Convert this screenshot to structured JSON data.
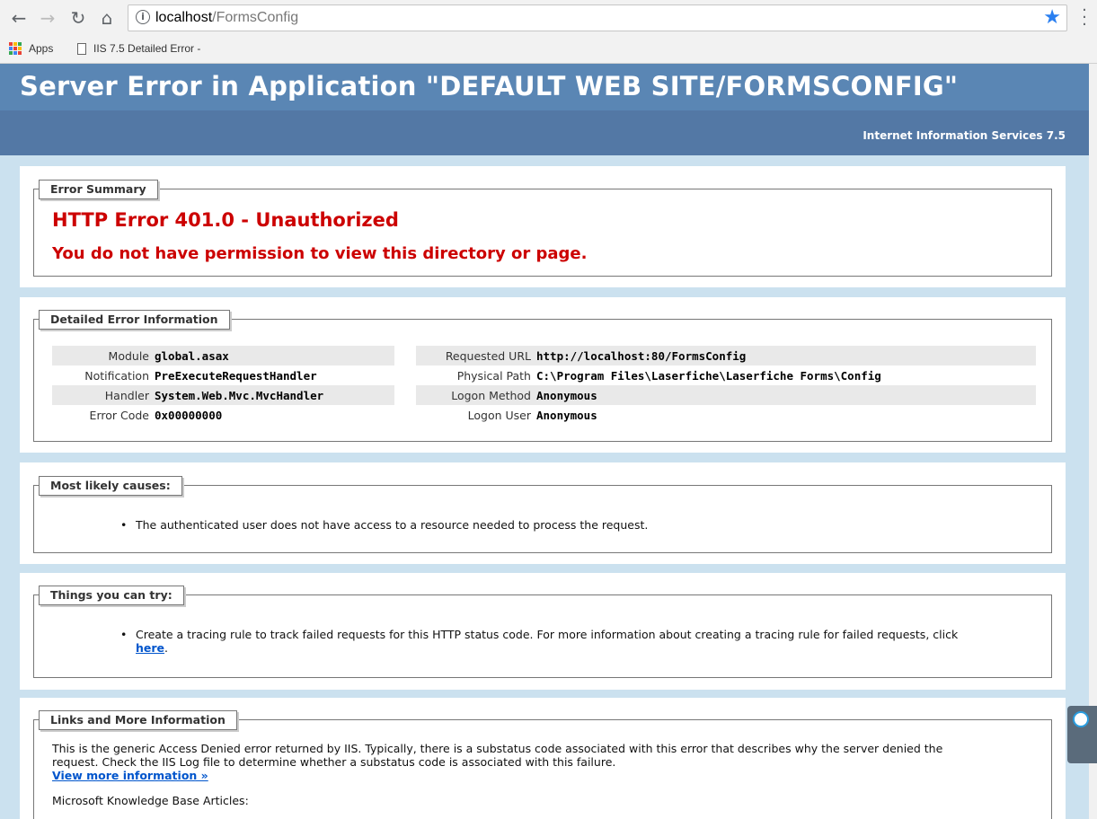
{
  "browser": {
    "url_host": "localhost",
    "url_path": "/FormsConfig",
    "bookmarks": [
      {
        "label": "Apps"
      },
      {
        "label": "IIS 7.5 Detailed Error -"
      }
    ]
  },
  "header": {
    "title": "Server Error in Application \"DEFAULT WEB SITE/FORMSCONFIG\"",
    "subtitle": "Internet Information Services 7.5"
  },
  "summary": {
    "legend": "Error Summary",
    "error_title": "HTTP Error 401.0 - Unauthorized",
    "error_message": "You do not have permission to view this directory or page."
  },
  "details": {
    "legend": "Detailed Error Information",
    "left": [
      {
        "key": "Module",
        "value": "global.asax"
      },
      {
        "key": "Notification",
        "value": "PreExecuteRequestHandler"
      },
      {
        "key": "Handler",
        "value": "System.Web.Mvc.MvcHandler"
      },
      {
        "key": "Error Code",
        "value": "0x00000000"
      }
    ],
    "right": [
      {
        "key": "Requested URL",
        "value": "http://localhost:80/FormsConfig"
      },
      {
        "key": "Physical Path",
        "value": "C:\\Program Files\\Laserfiche\\Laserfiche Forms\\Config"
      },
      {
        "key": "Logon Method",
        "value": "Anonymous"
      },
      {
        "key": "Logon User",
        "value": "Anonymous"
      }
    ]
  },
  "causes": {
    "legend": "Most likely causes:",
    "items": [
      "The authenticated user does not have access to a resource needed to process the request."
    ]
  },
  "try": {
    "legend": "Things you can try:",
    "item_line1": "Create a tracing rule to track failed requests for this HTTP status code. For more information about creating a tracing rule for failed requests, click",
    "link_text": "here",
    "item_end": "."
  },
  "links": {
    "legend": "Links and More Information",
    "para_line1": "This is the generic Access Denied error returned by IIS. Typically, there is a substatus code associated with this error that describes why the server denied the",
    "para_line2": "request. Check the IIS Log file to determine whether a substatus code is associated with this failure.",
    "view_more": "View more information »",
    "kb": "Microsoft Knowledge Base Articles:"
  },
  "colors": {
    "banner": "#5a86b4",
    "error_red": "#cc0000",
    "page_bg": "#cbe1ef"
  }
}
